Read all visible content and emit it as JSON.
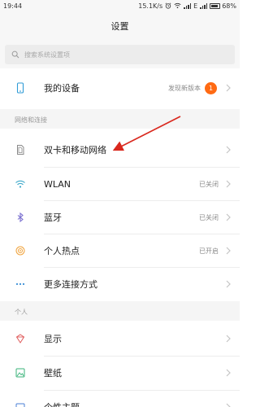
{
  "status_bar": {
    "time": "19:44",
    "network_speed": "15.1K/s",
    "alarm_icon": "alarm-icon",
    "wifi_icon": "wifi-icon",
    "signal_icon": "signal-icon",
    "network_type": "E",
    "battery_level": "68%",
    "battery_fraction": 0.68
  },
  "header": {
    "title": "设置"
  },
  "search": {
    "placeholder": "搜索系统设置项"
  },
  "my_device": {
    "label": "我的设备",
    "status": "发现新版本",
    "badge": "1",
    "badge_color": "#ff6a13",
    "icon": "phone-icon"
  },
  "sections": {
    "network": {
      "title": "网络和连接"
    },
    "personal": {
      "title": "个人"
    }
  },
  "network_items": [
    {
      "label": "双卡和移动网络",
      "status": "",
      "icon": "sim-card-icon"
    },
    {
      "label": "WLAN",
      "status": "已关闭",
      "icon": "wifi-icon"
    },
    {
      "label": "蓝牙",
      "status": "已关闭",
      "icon": "bluetooth-icon"
    },
    {
      "label": "个人热点",
      "status": "已开启",
      "icon": "hotspot-icon"
    },
    {
      "label": "更多连接方式",
      "status": "",
      "icon": "more-dots-icon"
    }
  ],
  "personal_items": [
    {
      "label": "显示",
      "icon": "display-icon"
    },
    {
      "label": "壁纸",
      "icon": "wallpaper-icon"
    },
    {
      "label": "个性主题",
      "icon": "theme-icon"
    }
  ],
  "annotation": {
    "color": "#d9281e"
  }
}
